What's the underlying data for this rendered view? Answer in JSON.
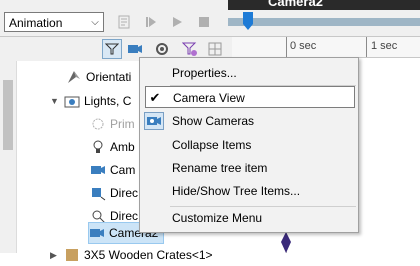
{
  "toolbar": {
    "mode_select": "Animation",
    "mode_arrow": "⌵",
    "timeline_title": "Camera2",
    "buttons": [
      "calculate-icon",
      "play-icon",
      "play-from-start-icon",
      "stop-icon"
    ]
  },
  "filter_toolbar": {
    "buttons": [
      "filter-icon",
      "camera-filter-icon",
      "settings-filter-icon",
      "funnel-purple-icon",
      "grid-icon"
    ]
  },
  "timeline": {
    "labels": [
      "0 sec",
      "1 sec"
    ]
  },
  "tree": {
    "items": [
      {
        "label": "Orientati",
        "icon": "orientation-icon",
        "indent": 1,
        "expander": ""
      },
      {
        "label": "Lights, C",
        "icon": "lights-cameras-folder-icon",
        "indent": 0,
        "expander": "▼"
      },
      {
        "label": "Prim",
        "icon": "primary-light-icon",
        "indent": 1,
        "expander": "",
        "disabled": true
      },
      {
        "label": "Amb",
        "icon": "ambient-light-icon",
        "indent": 1,
        "expander": ""
      },
      {
        "label": "Cam",
        "icon": "camera-icon",
        "indent": 1,
        "expander": ""
      },
      {
        "label": "Direc",
        "icon": "directional-light-icon",
        "indent": 1,
        "expander": ""
      },
      {
        "label": "Direc",
        "icon": "directional-light-icon",
        "indent": 1,
        "expander": ""
      },
      {
        "label": "Camera2",
        "icon": "camera-icon",
        "indent": 1,
        "expander": "",
        "selected": true
      },
      {
        "label": "3X5 Wooden Crates<1>",
        "icon": "part-icon",
        "indent": 0,
        "expander": "▶"
      }
    ]
  },
  "context_menu": {
    "items": [
      {
        "label": "Properties...",
        "icon": "",
        "checked": false
      },
      {
        "label": "Camera View",
        "icon": "check-icon",
        "checked": true,
        "hover": true
      },
      {
        "label": "Show Cameras",
        "icon": "show-cameras-icon",
        "checked": false
      },
      {
        "label": "Collapse Items",
        "icon": "",
        "checked": false
      },
      {
        "label": "Rename tree item",
        "icon": "",
        "checked": false
      },
      {
        "label": "Hide/Show Tree Items...",
        "icon": "",
        "checked": false
      },
      {
        "label": "Customize Menu",
        "icon": "",
        "checked": false
      }
    ],
    "check_glyph": "✔"
  },
  "colors": {
    "selection": "#cce4f7",
    "accent_blue": "#1e7bd6",
    "timeline_track": "#9fb6c6"
  }
}
